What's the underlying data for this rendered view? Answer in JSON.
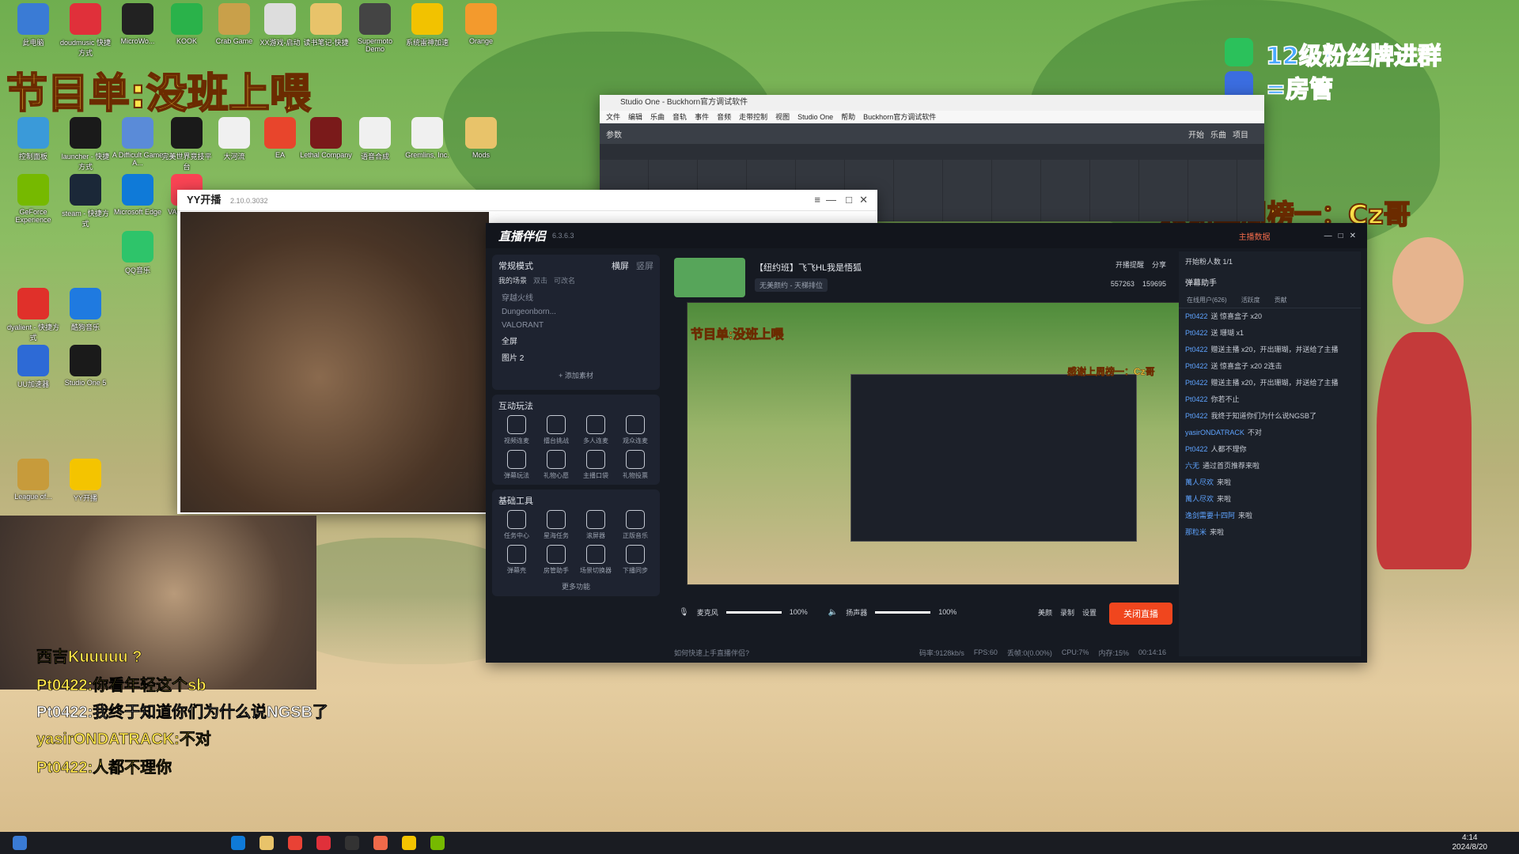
{
  "overlay": {
    "program_list": "节目单:没班上喂",
    "fan_badge": "12级粉丝牌进群",
    "room_manager": "=房管",
    "thanks": "感谢上周榜一：Cz哥"
  },
  "desktop_icons": [
    {
      "label": "此电脑",
      "color": "#3a7bd5"
    },
    {
      "label": "doudmusic 快捷方式",
      "color": "#e0303a"
    },
    {
      "label": "MicroWo...",
      "color": "#222"
    },
    {
      "label": "KOOK",
      "color": "#2ab24a"
    },
    {
      "label": "Crab Game",
      "color": "#c9a04a"
    },
    {
      "label": "XX游戏-启动",
      "color": "#ddd"
    },
    {
      "label": "读书笔记-快捷",
      "color": "#e8c36a"
    },
    {
      "label": "Supermoto Demo",
      "color": "#444"
    },
    {
      "label": "系统雷神加速",
      "color": "#f2c200"
    },
    {
      "label": "Orange",
      "color": "#f39a2d"
    },
    {
      "label": "控制面板",
      "color": "#3a9ad9"
    },
    {
      "label": "launcher - 快捷方式",
      "color": "#1a1a1a"
    },
    {
      "label": "A Difficult Game A...",
      "color": "#5a8bd8"
    },
    {
      "label": "完美世界竞技平台",
      "color": "#1a1a1a"
    },
    {
      "label": "大河流",
      "color": "#f0f0f0"
    },
    {
      "label": "EA",
      "color": "#e8452c"
    },
    {
      "label": "Lethal Company",
      "color": "#7a1a1a"
    },
    {
      "label": "语音合成",
      "color": "#f0f0f0"
    },
    {
      "label": "Gremlins, Inc.",
      "color": "#f0f0f0"
    },
    {
      "label": "Mods",
      "color": "#e8c36a"
    },
    {
      "label": "GeForce Experience",
      "color": "#76b900"
    },
    {
      "label": "steam - 快捷方式",
      "color": "#1b2838"
    },
    {
      "label": "Microsoft Edge",
      "color": "#0f7ad8"
    },
    {
      "label": "VALORANT",
      "color": "#fa4454"
    },
    {
      "label": "dyalient - 快捷方式",
      "color": "#e0302a"
    },
    {
      "label": "酷狗音乐",
      "color": "#1f7ae0"
    },
    {
      "label": "UU加速器",
      "color": "#2d6ad6"
    },
    {
      "label": "Studio One 5",
      "color": "#1a1a1a"
    },
    {
      "label": "QQ音乐",
      "color": "#2ec46a"
    },
    {
      "label": "League of...",
      "color": "#c79b3b"
    },
    {
      "label": "YY开播",
      "color": "#f4c400"
    }
  ],
  "studio_one": {
    "title": "Studio One - Buckhorn官方调试软件",
    "menu": [
      "文件",
      "编辑",
      "乐曲",
      "音轨",
      "事件",
      "音频",
      "走带控制",
      "视图",
      "Studio One",
      "帮助",
      "Buckhorn官方调试软件"
    ],
    "toolbar_labels": [
      "参数",
      "开始",
      "乐曲",
      "项目"
    ]
  },
  "yy": {
    "title": "YY开播",
    "version": "2.10.0.3032"
  },
  "zhibo": {
    "app_name": "直播伴侣",
    "version": "6.3.6.3",
    "mode": "常规模式",
    "landscape": "横屏",
    "portrait": "竖屏",
    "my_scenes": "我的场景",
    "dual_stream": "双击",
    "changeable": "可改名",
    "sources": [
      "穿越火线",
      "Dungeonborn...",
      "VALORANT",
      "全屏",
      "图片 2"
    ],
    "add_material": "+ 添加素材",
    "interactive_title": "互动玩法",
    "interactive": [
      "视频连麦",
      "擂台挑战",
      "多人连麦",
      "观众连麦",
      "弹幕玩法",
      "礼物心愿",
      "主播口袋",
      "礼物投票"
    ],
    "basic_tools_title": "基础工具",
    "basic_tools": [
      "任务中心",
      "星海任务",
      "滚屏器",
      "正版音乐",
      "弹幕壳",
      "房管助手",
      "场景切换器",
      "下播同步"
    ],
    "more_functions": "更多功能",
    "stream_title": "【纽约班】飞飞HL我是悟狐",
    "stream_sub": "无美颜约 - 天梯排位",
    "stats": {
      "likes": "557263",
      "hearts": "159695"
    },
    "mic_label": "麦克风",
    "mic_volume": "100%",
    "speaker_label": "扬声器",
    "speaker_volume": "100%",
    "right_buttons": [
      "美颜",
      "录制",
      "设置"
    ],
    "end_live": "关闭直播",
    "help_text": "如何快速上手直播伴侣?",
    "status": {
      "bitrate": "码率:9128kb/s",
      "fps": "FPS:60",
      "drop": "丢帧:0(0.00%)",
      "cpu": "CPU:7%",
      "mem": "内存:15%",
      "time": "00:14:16"
    },
    "top_right": {
      "host_data": "主播数据",
      "broadcast_remind": "开播提醒",
      "share": "分享"
    },
    "online_label": "开始粉人数",
    "online_count": "1/1",
    "danmu_helper": "弹幕助手",
    "tabs": [
      "在线用户(626)",
      "活跃度",
      "贡献"
    ],
    "chat": [
      {
        "user": "Pt0422",
        "text": "送 惊喜盒子 x20"
      },
      {
        "user": "Pt0422",
        "text": "送 珊瑚 x1"
      },
      {
        "user": "Pt0422",
        "text": "赠送主播 x20，开出珊瑚，并送给了主播"
      },
      {
        "user": "Pt0422",
        "text": "送 惊喜盒子 x20 2连击"
      },
      {
        "user": "Pt0422",
        "text": "赠送主播 x20，开出珊瑚，并送给了主播"
      },
      {
        "user": "Pt0422",
        "text": "你若不止"
      },
      {
        "user": "Pt0422",
        "text": "我终于知道你们为什么说NGSB了"
      },
      {
        "user": "yasirONDATRACK",
        "text": "不对"
      },
      {
        "user": "Pt0422",
        "text": "人都不理你"
      },
      {
        "user": "六无",
        "text": "通过首页推荐来啦"
      },
      {
        "user": "萬人尽欢",
        "text": "来啦"
      },
      {
        "user": "萬人尽欢",
        "text": "来啦"
      },
      {
        "user": "逸剑需要十四阿",
        "text": "来啦"
      },
      {
        "user": "那粒米",
        "text": "来啦"
      }
    ]
  },
  "overlay_chat": [
    {
      "text": "西吉Kuuuuu ?",
      "color": "#ffe44a"
    },
    {
      "text": "Pt0422:你看年轻这个sb",
      "color": "#ffe44a"
    },
    {
      "text": "Pt0422:我终于知道你们为什么说NGSB了",
      "color": "#ffffff"
    },
    {
      "text": "yasirONDATRACK:不对",
      "color": "#ffe44a"
    },
    {
      "text": "Pt0422:人都不理你",
      "color": "#ffe44a"
    }
  ],
  "taskbar": {
    "time": "4:14",
    "date": "2024/8/20"
  }
}
